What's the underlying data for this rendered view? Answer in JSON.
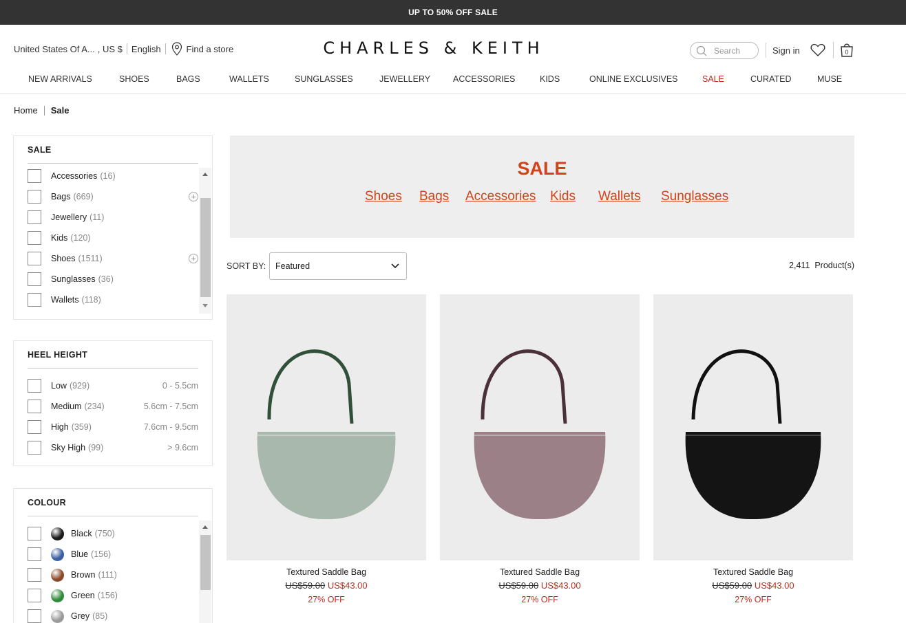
{
  "promo": {
    "text": "UP TO 50% OFF SALE"
  },
  "header": {
    "region": "United States Of A...",
    "currency": ", US $",
    "language": "English",
    "find_store": "Find a store",
    "logo": "CHARLES & KEITH",
    "search_placeholder": "Search",
    "sign_in": "Sign in",
    "bag_count": "0"
  },
  "nav": [
    "NEW ARRIVALS",
    "SHOES",
    "BAGS",
    "WALLETS",
    "SUNGLASSES",
    "JEWELLERY",
    "ACCESSORIES",
    "KIDS",
    "ONLINE EXCLUSIVES",
    "SALE",
    "CURATED",
    "MUSE"
  ],
  "breadcrumb": {
    "home": "Home",
    "current": "Sale"
  },
  "filters": {
    "sale": {
      "title": "SALE",
      "items": [
        {
          "label": "Accessories",
          "count": "(16)"
        },
        {
          "label": "Bags",
          "count": "(669)"
        },
        {
          "label": "Jewellery",
          "count": "(11)"
        },
        {
          "label": "Kids",
          "count": "(120)"
        },
        {
          "label": "Shoes",
          "count": "(1511)"
        },
        {
          "label": "Sunglasses",
          "count": "(36)"
        },
        {
          "label": "Wallets",
          "count": "(118)"
        }
      ]
    },
    "heel": {
      "title": "HEEL HEIGHT",
      "items": [
        {
          "label": "Low",
          "count": "(929)",
          "range": "0 - 5.5cm"
        },
        {
          "label": "Medium",
          "count": "(234)",
          "range": "5.6cm - 7.5cm"
        },
        {
          "label": "High",
          "count": "(359)",
          "range": "7.6cm - 9.5cm"
        },
        {
          "label": "Sky High",
          "count": "(99)",
          "range": "> 9.6cm"
        }
      ]
    },
    "colour": {
      "title": "COLOUR",
      "items": [
        {
          "label": "Black",
          "count": "(750)",
          "color": "#1a1a1a"
        },
        {
          "label": "Blue",
          "count": "(156)",
          "color": "#3a5ea0"
        },
        {
          "label": "Brown",
          "count": "(111)",
          "color": "#8a4a2a"
        },
        {
          "label": "Green",
          "count": "(156)",
          "color": "#2e8b3a"
        },
        {
          "label": "Grey",
          "count": "(85)",
          "color": "#9a9a9a"
        }
      ]
    }
  },
  "banner": {
    "title": "SALE",
    "links": [
      "Shoes",
      "Bags",
      "Accessories",
      "Kids",
      "Wallets",
      "Sunglasses"
    ]
  },
  "sort": {
    "label": "SORT BY:",
    "value": "Featured"
  },
  "product_count": "2,411  Product(s)",
  "products": [
    {
      "name": "Textured Saddle Bag",
      "original_price": "US$59.00",
      "sale_price": "US$43.00",
      "discount": "27% OFF",
      "bag_color": "#a9b8ac",
      "strap_color": "#31503a"
    },
    {
      "name": "Textured Saddle Bag",
      "original_price": "US$59.00",
      "sale_price": "US$43.00",
      "discount": "27% OFF",
      "bag_color": "#9c8088",
      "strap_color": "#4a3038"
    },
    {
      "name": "Textured Saddle Bag",
      "original_price": "US$59.00",
      "sale_price": "US$43.00",
      "discount": "27% OFF",
      "bag_color": "#141414",
      "strap_color": "#111111"
    }
  ]
}
